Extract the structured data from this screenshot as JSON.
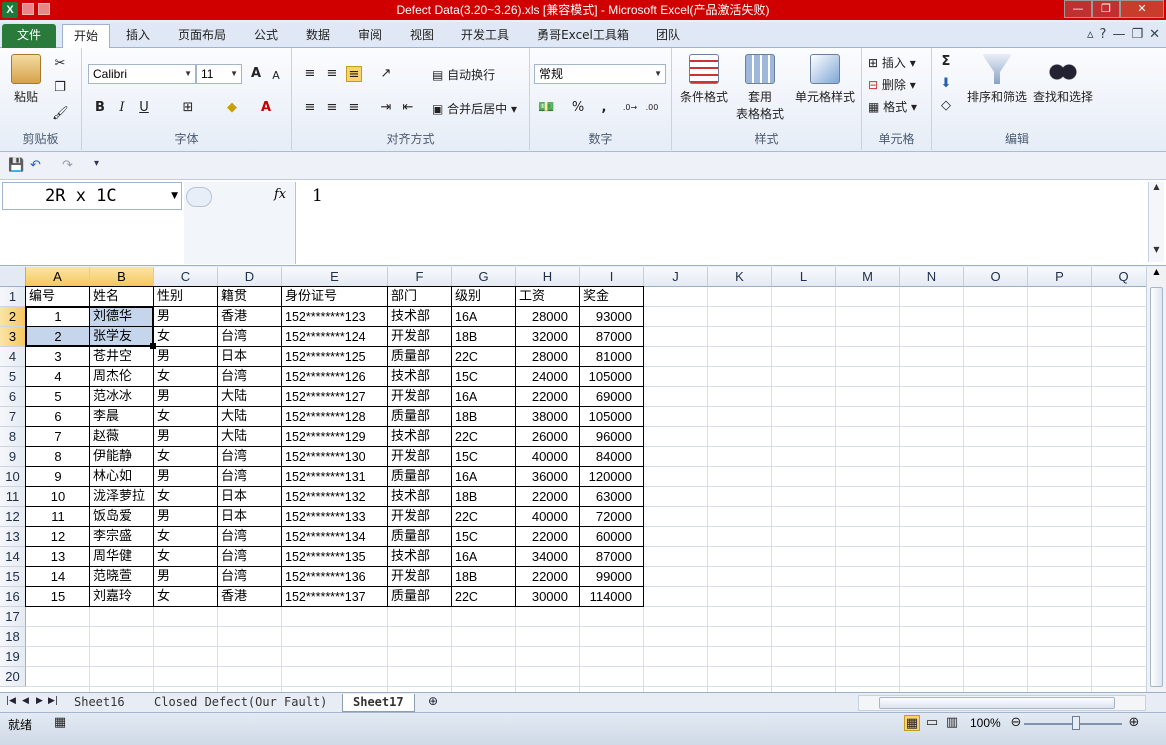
{
  "window": {
    "title": "Defect Data(3.20~3.26).xls  [兼容模式]  -  Microsoft Excel(产品激活失败)",
    "logo": "X",
    "controls": [
      "—",
      "❐",
      "✕"
    ]
  },
  "menu": {
    "file": "文件",
    "tabs": [
      "开始",
      "插入",
      "页面布局",
      "公式",
      "数据",
      "审阅",
      "视图",
      "开发工具",
      "勇哥Excel工具箱",
      "团队"
    ]
  },
  "ribbon": {
    "clipboard": {
      "paste": "粘贴",
      "label": "剪贴板"
    },
    "font": {
      "name": "Calibri",
      "size": "11",
      "label": "字体",
      "bold": "B",
      "italic": "I",
      "underline": "U"
    },
    "alignment": {
      "wrap": "自动换行",
      "merge": "合并后居中",
      "label": "对齐方式"
    },
    "number": {
      "format": "常规",
      "percent": "%",
      "comma": ",",
      "inc": ".0→.00",
      "dec": ".00→.0",
      "label": "数字"
    },
    "styles": {
      "conditional": "条件格式",
      "table_line1": "套用",
      "table_line2": "表格格式",
      "cell_styles": "单元格样式",
      "label": "样式"
    },
    "cells": {
      "insert": "插入",
      "delete": "删除",
      "format": "格式",
      "label": "单元格"
    },
    "editing": {
      "sort": "排序和筛选",
      "find": "查找和选择",
      "label": "编辑",
      "sum": "Σ"
    }
  },
  "formula_bar": {
    "name_box": "2R x 1C",
    "fx": "fx",
    "content": "1"
  },
  "columns": [
    "A",
    "B",
    "C",
    "D",
    "E",
    "F",
    "G",
    "H",
    "I",
    "J",
    "K",
    "L",
    "M",
    "N",
    "O",
    "P",
    "Q"
  ],
  "rows": [
    "1",
    "2",
    "3",
    "4",
    "5",
    "6",
    "7",
    "8",
    "9",
    "10",
    "11",
    "12",
    "13",
    "14",
    "15",
    "16",
    "17",
    "18",
    "19",
    "20"
  ],
  "table": {
    "headers": [
      "编号",
      "姓名",
      "性别",
      "籍贯",
      "身份证号",
      "部门",
      "级别",
      "工资",
      "奖金"
    ],
    "rows": [
      [
        "1",
        "刘德华",
        "男",
        "香港",
        "152********123",
        "技术部",
        "16A",
        "28000",
        "93000"
      ],
      [
        "2",
        "张学友",
        "女",
        "台湾",
        "152********124",
        "开发部",
        "18B",
        "32000",
        "87000"
      ],
      [
        "3",
        "苍井空",
        "男",
        "日本",
        "152********125",
        "质量部",
        "22C",
        "28000",
        "81000"
      ],
      [
        "4",
        "周杰伦",
        "女",
        "台湾",
        "152********126",
        "技术部",
        "15C",
        "24000",
        "105000"
      ],
      [
        "5",
        "范冰冰",
        "男",
        "大陆",
        "152********127",
        "开发部",
        "16A",
        "22000",
        "69000"
      ],
      [
        "6",
        "李晨",
        "女",
        "大陆",
        "152********128",
        "质量部",
        "18B",
        "38000",
        "105000"
      ],
      [
        "7",
        "赵薇",
        "男",
        "大陆",
        "152********129",
        "技术部",
        "22C",
        "26000",
        "96000"
      ],
      [
        "8",
        "伊能静",
        "女",
        "台湾",
        "152********130",
        "开发部",
        "15C",
        "40000",
        "84000"
      ],
      [
        "9",
        "林心如",
        "男",
        "台湾",
        "152********131",
        "质量部",
        "16A",
        "36000",
        "120000"
      ],
      [
        "10",
        "泷泽萝拉",
        "女",
        "日本",
        "152********132",
        "技术部",
        "18B",
        "22000",
        "63000"
      ],
      [
        "11",
        "饭岛爱",
        "男",
        "日本",
        "152********133",
        "开发部",
        "22C",
        "40000",
        "72000"
      ],
      [
        "12",
        "李宗盛",
        "女",
        "台湾",
        "152********134",
        "质量部",
        "15C",
        "22000",
        "60000"
      ],
      [
        "13",
        "周华健",
        "女",
        "台湾",
        "152********135",
        "技术部",
        "16A",
        "34000",
        "87000"
      ],
      [
        "14",
        "范晓萱",
        "男",
        "台湾",
        "152********136",
        "开发部",
        "18B",
        "22000",
        "99000"
      ],
      [
        "15",
        "刘嘉玲",
        "女",
        "香港",
        "152********137",
        "质量部",
        "22C",
        "30000",
        "114000"
      ]
    ]
  },
  "sheets": {
    "tabs": [
      "Sheet16",
      "Closed Defect(Our Fault)",
      "Sheet17"
    ],
    "active": "Sheet17"
  },
  "status": {
    "ready": "就绪",
    "zoom": "100%",
    "minus": "⊖",
    "plus": "⊕"
  }
}
